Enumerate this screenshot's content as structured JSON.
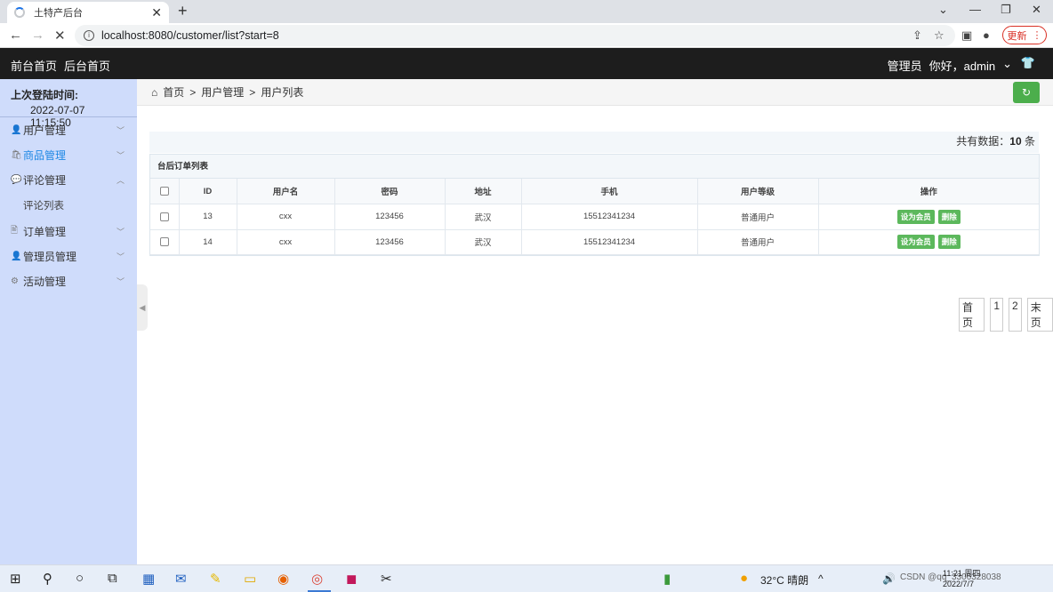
{
  "browser": {
    "tab_title": "土特产后台",
    "tab_close": "✕",
    "new_tab": "+",
    "url": "localhost:8080/customer/list?start=8",
    "update_label": "更新",
    "window_controls": [
      "⌄",
      "—",
      "❐",
      "✕"
    ],
    "nav": {
      "back": "←",
      "forward": "→",
      "reload": "✕"
    }
  },
  "header": {
    "links": [
      "前台首页",
      "后台首页"
    ],
    "role": "管理员",
    "greeting": "你好，admin",
    "caret": "⌄"
  },
  "sidebar": {
    "last_login_label": "上次登陆时间:",
    "last_login_time": "2022-07-07 11:15:50",
    "items": [
      {
        "label": "用户管理",
        "icon": "user-icon",
        "glyph": "👤",
        "expanded": false,
        "active": false
      },
      {
        "label": "商品管理",
        "icon": "bag-icon",
        "glyph": "🛍",
        "expanded": false,
        "active": true
      },
      {
        "label": "评论管理",
        "icon": "comment-icon",
        "glyph": "💬",
        "expanded": true,
        "active": false
      },
      {
        "label": "订单管理",
        "icon": "order-icon",
        "glyph": "🖹",
        "expanded": false,
        "active": false
      },
      {
        "label": "管理员管理",
        "icon": "admin-icon",
        "glyph": "👤",
        "expanded": false,
        "active": false
      },
      {
        "label": "活动管理",
        "icon": "gear-icon",
        "glyph": "⚙",
        "expanded": false,
        "active": false
      }
    ],
    "submenu_comments": "评论列表"
  },
  "breadcrumb": {
    "home": "首页",
    "sep": ">",
    "level1": "用户管理",
    "level2": "用户列表"
  },
  "summary": {
    "prefix": "共有数据：",
    "count": "10",
    "suffix": " 条"
  },
  "table": {
    "title": "台后订单列表",
    "columns": [
      "ID",
      "用户名",
      "密码",
      "地址",
      "手机",
      "用户等级",
      "操作"
    ],
    "rows": [
      {
        "id": "13",
        "username": "cxx",
        "password": "123456",
        "address": "武汉",
        "phone": "15512341234",
        "level": "普通用户"
      },
      {
        "id": "14",
        "username": "cxx",
        "password": "123456",
        "address": "武汉",
        "phone": "15512341234",
        "level": "普通用户"
      }
    ],
    "action_member": "设为会员",
    "action_delete": "删除"
  },
  "pagination": [
    "首页",
    "1",
    "2",
    "末页"
  ],
  "taskbar": {
    "weather": "32°C  晴朗",
    "time": "11:21 周四",
    "date": "2022/7/7",
    "watermark": "CSDN @qq_3306328038"
  },
  "colors": {
    "header_bg": "#1d1d1d",
    "sidebar_bg": "#cfdcfb",
    "accent_green": "#5cb85c",
    "active_link": "#1e88e5"
  }
}
